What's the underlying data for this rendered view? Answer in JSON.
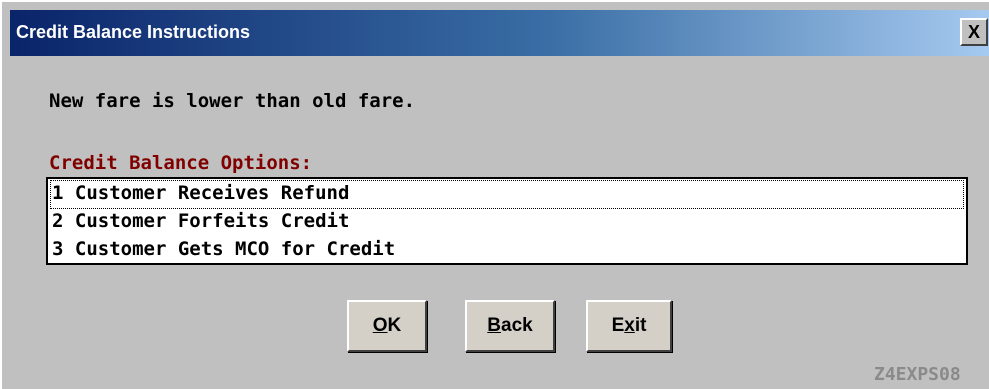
{
  "window": {
    "title": "Credit Balance Instructions",
    "close_glyph": "X"
  },
  "message": "New fare is lower than old fare.",
  "options": {
    "heading": "Credit Balance Options:",
    "items": [
      {
        "label": "1 Customer Receives Refund",
        "selected": true
      },
      {
        "label": "2 Customer Forfeits Credit",
        "selected": false
      },
      {
        "label": "3 Customer Gets MCO for Credit",
        "selected": false
      }
    ]
  },
  "buttons": {
    "ok": {
      "mnemonic": "O",
      "rest": "K"
    },
    "back": {
      "mnemonic": "B",
      "rest": "ack"
    },
    "exit": {
      "before": "E",
      "mnemonic": "x",
      "after": "it"
    }
  },
  "screen_code": "Z4EXPS08",
  "colors": {
    "face": "#c0c0c0",
    "title_gradient_start": "#0a246a",
    "title_gradient_end": "#a6caf0",
    "heading": "#800000",
    "screen_code": "#8a8a8a"
  }
}
